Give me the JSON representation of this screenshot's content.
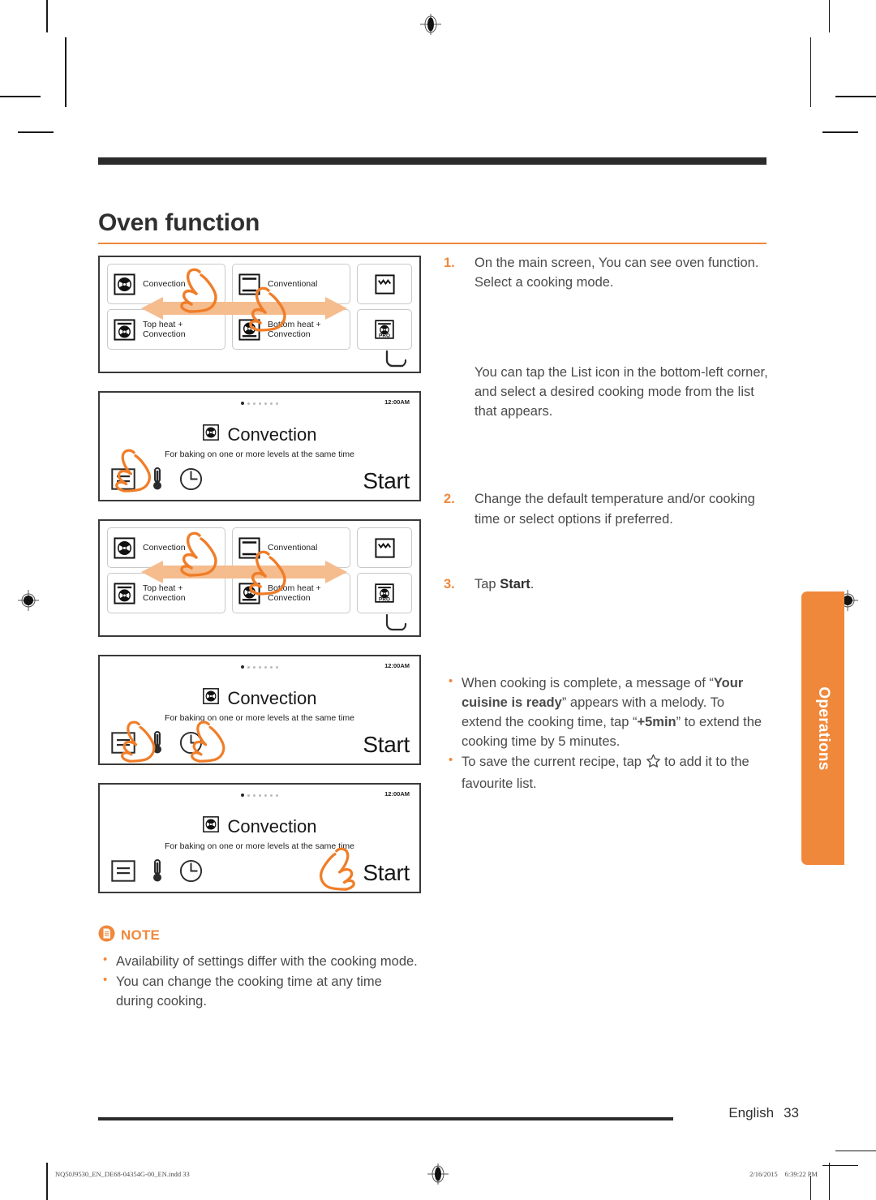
{
  "document": {
    "title": "Oven function",
    "footer_language": "English",
    "footer_page": "33",
    "imprint_file": "NQ50J9530_EN_DE68-04354G-00_EN.indd   33",
    "imprint_date": "2/16/2015",
    "imprint_time": "6:39:22 PM",
    "side_tab": "Operations",
    "accent_color": "#f0883c",
    "arrow_color": "#f5bc8e",
    "text_color": "#4a4a4a"
  },
  "steps": [
    {
      "number": "1.",
      "text": "On the main screen, You can see oven function. Select a cooking mode."
    },
    {
      "number": "2.",
      "text": "Change the default temperature and/or cooking time or select options if preferred."
    },
    {
      "number": "3.",
      "text_prefix": "Tap ",
      "text_bold": "Start",
      "text_suffix": "."
    }
  ],
  "paragraph_list_icon": "You can tap the List icon in the bottom-left corner, and select a desired cooking mode from the list that appears.",
  "right_bullets": [
    {
      "p1": "When cooking is complete, a message of “",
      "b1": "Your cuisine is ready",
      "p2": "” appears with a melody. To extend the cooking time, tap “",
      "b2": "+5min",
      "p3": "” to extend the cooking time by 5 minutes."
    },
    {
      "p1": "To save the current recipe, tap ",
      "b1": "",
      "p2": " to add it to the favourite list.",
      "b2": "",
      "p3": ""
    }
  ],
  "note": {
    "label": "NOTE",
    "icon": "document-icon",
    "bullets": [
      "Availability of settings differ with the cooking mode.",
      "You can change the cooking time at any time during cooking."
    ]
  },
  "screens": {
    "mode_list": {
      "cells": [
        {
          "label": "Convection",
          "icon": "convection-fan-icon"
        },
        {
          "label": "Conventional",
          "icon": "conventional-icon"
        },
        {
          "label": "",
          "icon": "grill-icon"
        },
        {
          "label": "Top heat + Convection",
          "icon": "top-heat-convection-icon"
        },
        {
          "label": "Bottom heat + Convection",
          "icon": "bottom-heat-convection-icon"
        },
        {
          "label": "PRO",
          "icon": "pro-convection-icon"
        }
      ],
      "back_icon": "back-arrow-icon"
    },
    "detail": {
      "time": "12:00",
      "meridiem": "AM",
      "mode_icon": "convection-fan-icon",
      "mode_title": "Convection",
      "description": "For baking on one or more levels at the same time",
      "dock": [
        {
          "icon": "list-icon",
          "name": "list"
        },
        {
          "icon": "thermometer-icon",
          "name": "temperature"
        },
        {
          "icon": "clock-icon",
          "name": "cooking-time"
        }
      ],
      "start_label": "Start"
    }
  }
}
